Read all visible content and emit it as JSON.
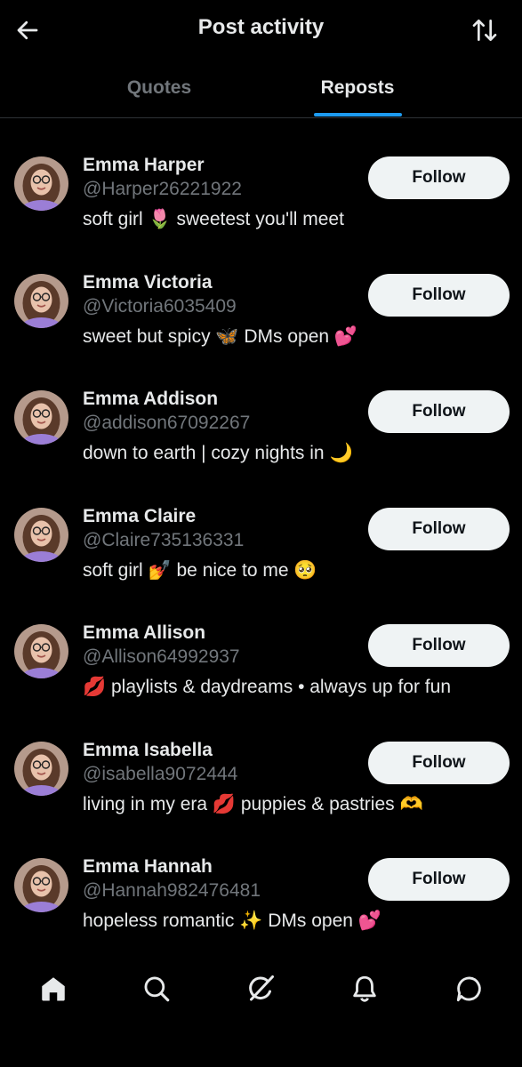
{
  "header": {
    "title": "Post activity",
    "back_icon": "arrow-left-icon",
    "sort_icon": "sort-arrows-icon"
  },
  "tabs": [
    {
      "label": "Quotes",
      "active": false
    },
    {
      "label": "Reposts",
      "active": true
    }
  ],
  "colors": {
    "background": "#000000",
    "primary_text": "#e7e9ea",
    "secondary_text": "#71767b",
    "accent": "#1d9bf0",
    "follow_button_bg": "#eff3f4",
    "follow_button_text": "#0f1419"
  },
  "users": [
    {
      "name": "Emma Harper",
      "handle": "@Harper26221922",
      "bio": "soft girl 🌷 sweetest you'll meet",
      "follow_label": "Follow"
    },
    {
      "name": "Emma Victoria",
      "handle": "@Victoria6035409",
      "bio": "sweet but spicy 🦋 DMs open 💕",
      "follow_label": "Follow"
    },
    {
      "name": "Emma Addison",
      "handle": "@addison67092267",
      "bio": "down to earth | cozy nights in 🌙",
      "follow_label": "Follow"
    },
    {
      "name": "Emma Claire",
      "handle": "@Claire735136331",
      "bio": "soft girl 💅 be nice to me 🥺",
      "follow_label": "Follow"
    },
    {
      "name": "Emma Allison",
      "handle": "@Allison64992937",
      "bio": "💋 playlists & daydreams • always up for fun",
      "follow_label": "Follow"
    },
    {
      "name": "Emma Isabella",
      "handle": "@isabella9072444",
      "bio": "living in my era 💋 puppies & pastries 🫶",
      "follow_label": "Follow"
    },
    {
      "name": "Emma Hannah",
      "handle": "@Hannah982476481",
      "bio": "hopeless romantic ✨ DMs open 💕",
      "follow_label": "Follow"
    }
  ],
  "bottom_nav": [
    {
      "icon": "home-icon"
    },
    {
      "icon": "search-icon"
    },
    {
      "icon": "grok-icon"
    },
    {
      "icon": "notifications-bell-icon"
    },
    {
      "icon": "messages-icon"
    }
  ]
}
